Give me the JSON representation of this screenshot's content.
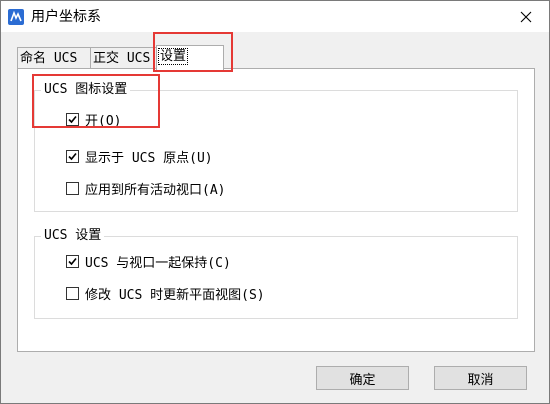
{
  "window": {
    "title": "用户坐标系",
    "close_glyph": "✕"
  },
  "tabs": [
    {
      "label": "命名 UCS",
      "active": false
    },
    {
      "label": "正交 UCS",
      "active": false
    },
    {
      "label": "设置",
      "active": true
    }
  ],
  "icon_settings": {
    "title": "UCS 图标设置",
    "options": [
      {
        "label": "开(O)",
        "checked": true
      },
      {
        "label": "显示于 UCS 原点(U)",
        "checked": true
      },
      {
        "label": "应用到所有活动视口(A)",
        "checked": false
      }
    ]
  },
  "ucs_settings": {
    "title": "UCS 设置",
    "options": [
      {
        "label": "UCS 与视口一起保持(C)",
        "checked": true
      },
      {
        "label": "修改 UCS 时更新平面视图(S)",
        "checked": false
      }
    ]
  },
  "buttons": {
    "ok": "确定",
    "cancel": "取消"
  },
  "colors": {
    "highlight": "#e53935",
    "app_icon": "#2b6cd3"
  }
}
